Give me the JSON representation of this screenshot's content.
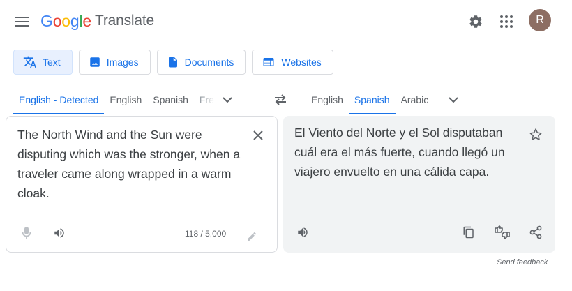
{
  "header": {
    "logo_letters": [
      "G",
      "o",
      "o",
      "g",
      "l",
      "e"
    ],
    "product": "Translate",
    "avatar_initial": "R"
  },
  "modes": [
    {
      "label": "Text",
      "icon": "translate-icon",
      "active": true
    },
    {
      "label": "Images",
      "icon": "image-icon",
      "active": false
    },
    {
      "label": "Documents",
      "icon": "document-icon",
      "active": false
    },
    {
      "label": "Websites",
      "icon": "website-icon",
      "active": false
    }
  ],
  "source_langs": {
    "detected": "English - Detected",
    "options": [
      "English",
      "Spanish",
      "French"
    ]
  },
  "target_langs": {
    "options": [
      "English",
      "Spanish",
      "Arabic"
    ],
    "active": "Spanish"
  },
  "source": {
    "text": "The North Wind and the Sun were disputing which was the stronger, when a traveler came along wrapped in a warm cloak.",
    "char_count": "118 / 5,000"
  },
  "target": {
    "text": "El Viento del Norte y el Sol disputaban cuál era el más fuerte, cuando llegó un viajero envuelto en una cálida capa."
  },
  "feedback": "Send feedback",
  "colors": {
    "accent": "#1a73e8",
    "active_bg": "#e8f0fe",
    "target_bg": "#f1f3f4",
    "avatar": "#8d6e63"
  }
}
